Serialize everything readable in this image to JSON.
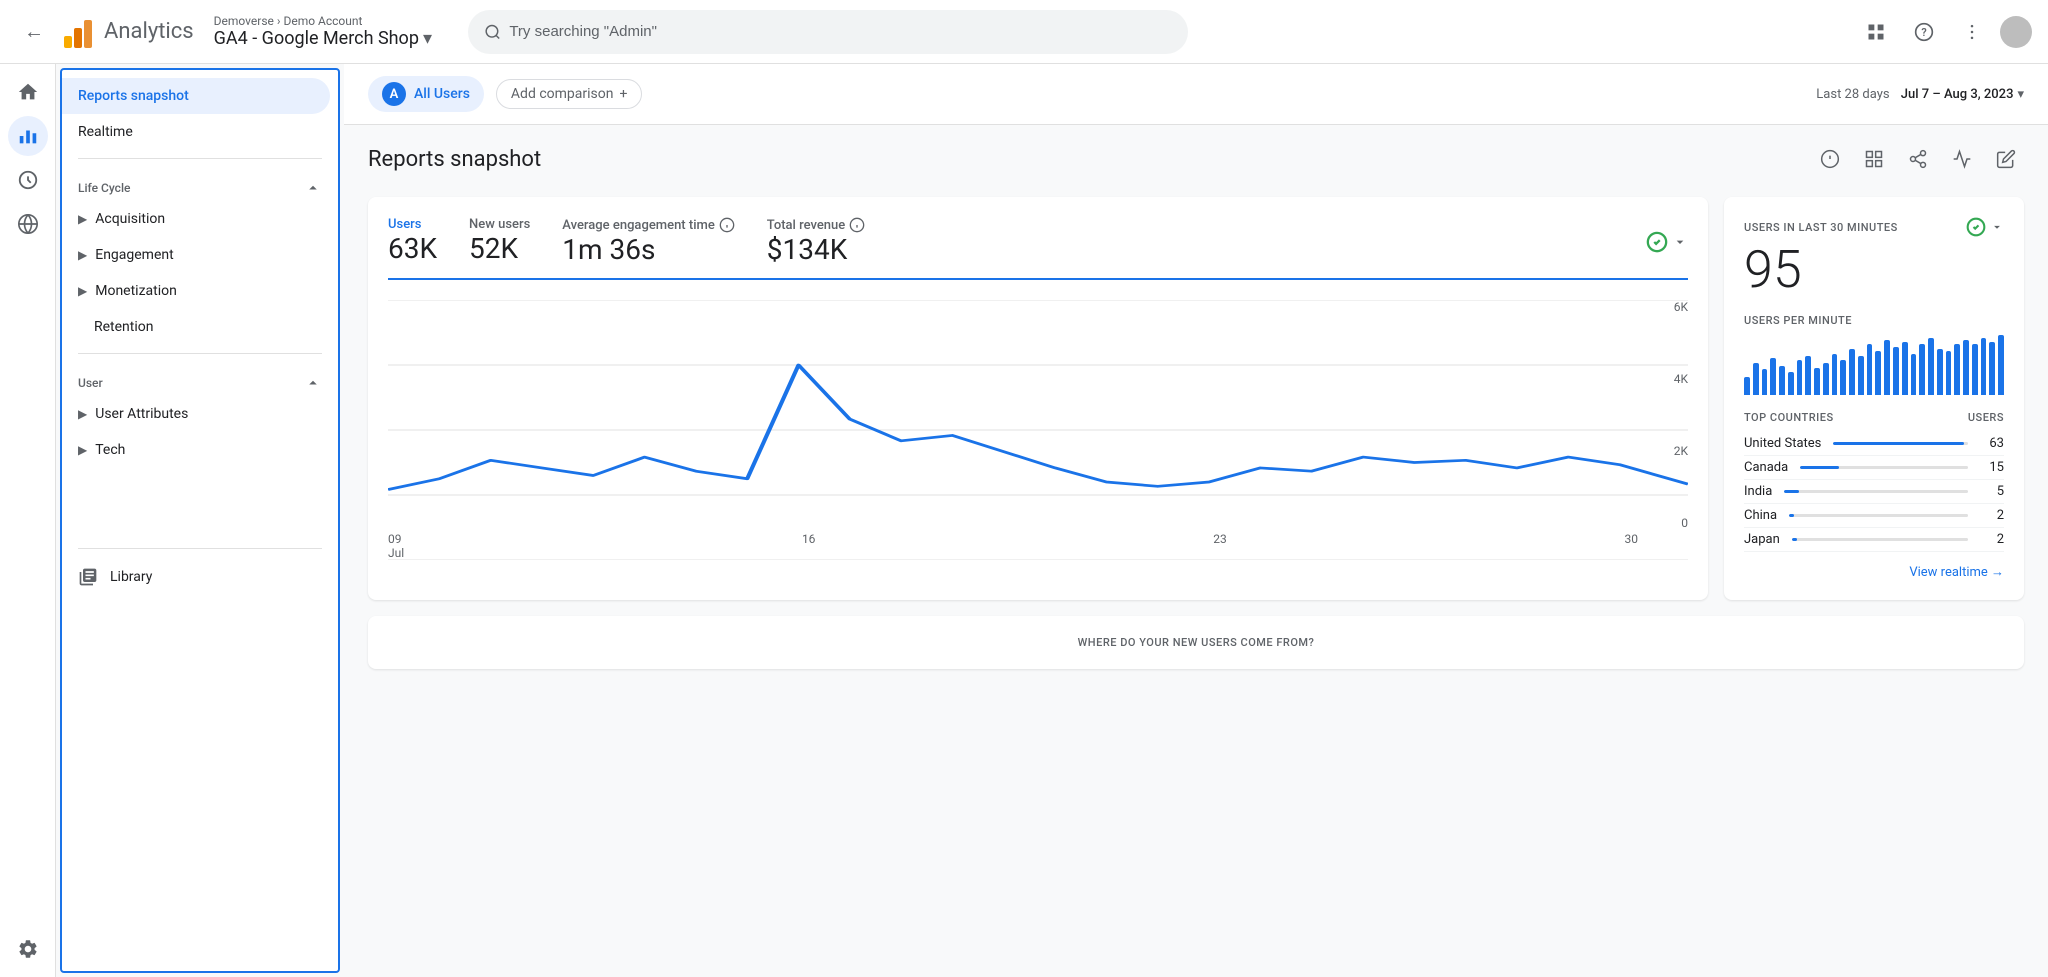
{
  "topbar": {
    "back_label": "←",
    "logo_alt": "Google Analytics",
    "app_title": "Analytics",
    "breadcrumb_top": "Demoverse › Demo Account",
    "breadcrumb_bottom": "GA4 - Google Merch Shop",
    "search_placeholder": "Try searching \"Admin\"",
    "icons": {
      "grid": "⊞",
      "help": "?",
      "more": "⋮"
    }
  },
  "comparison_bar": {
    "all_users_initial": "A",
    "all_users_label": "All Users",
    "add_comparison_label": "Add comparison",
    "add_comparison_icon": "+",
    "date_prefix": "Last 28 days",
    "date_range": "Jul 7 – Aug 3, 2023",
    "date_arrow": "▾"
  },
  "page": {
    "title": "Reports snapshot",
    "action_icons": [
      "💡",
      "⬜",
      "⬆",
      "〰",
      "✏"
    ]
  },
  "metrics": [
    {
      "label": "Users",
      "value": "63K",
      "highlight": true
    },
    {
      "label": "New users",
      "value": "52K"
    },
    {
      "label": "Average engagement time",
      "value": "1m 36s",
      "has_info": true
    },
    {
      "label": "Total revenue",
      "value": "$134K",
      "has_info": true,
      "has_check": true
    }
  ],
  "chart": {
    "y_labels": [
      "6K",
      "4K",
      "2K",
      "0"
    ],
    "x_labels": [
      "09\nJul",
      "16",
      "23",
      "30"
    ],
    "data_points": [
      30,
      38,
      45,
      40,
      38,
      42,
      38,
      70,
      48,
      42,
      45,
      40,
      42,
      38,
      32,
      38,
      40,
      42,
      38,
      40,
      45,
      42,
      38,
      40,
      38,
      35
    ]
  },
  "realtime": {
    "title": "USERS IN LAST 30 MINUTES",
    "value": "95",
    "upm_label": "USERS PER MINUTE",
    "bar_data": [
      20,
      35,
      28,
      40,
      32,
      25,
      38,
      42,
      30,
      35,
      45,
      38,
      50,
      42,
      55,
      48,
      60,
      52,
      58,
      45,
      55,
      62,
      50,
      48,
      55,
      60,
      55,
      62,
      58,
      65
    ],
    "countries_header_left": "TOP COUNTRIES",
    "countries_header_right": "USERS",
    "countries": [
      {
        "name": "United States",
        "count": 63,
        "pct": 97
      },
      {
        "name": "Canada",
        "count": 15,
        "pct": 23
      },
      {
        "name": "India",
        "count": 5,
        "pct": 8
      },
      {
        "name": "China",
        "count": 2,
        "pct": 3
      },
      {
        "name": "Japan",
        "count": 2,
        "pct": 3
      }
    ],
    "view_realtime": "View realtime →"
  },
  "sidebar": {
    "reports_snapshot": "Reports snapshot",
    "realtime": "Realtime",
    "lifecycle_label": "Life Cycle",
    "lifecycle_items": [
      "Acquisition",
      "Engagement",
      "Monetization",
      "Retention"
    ],
    "user_label": "User",
    "user_items": [
      "User Attributes",
      "Tech"
    ],
    "library": "Library"
  },
  "bottom": {
    "title": "WHERE DO YOUR NEW USERS COME FROM?"
  },
  "nav_icons": {
    "home": "🏠",
    "reports": "📊",
    "explore": "🔍",
    "advertising": "📡",
    "settings": "⚙"
  }
}
